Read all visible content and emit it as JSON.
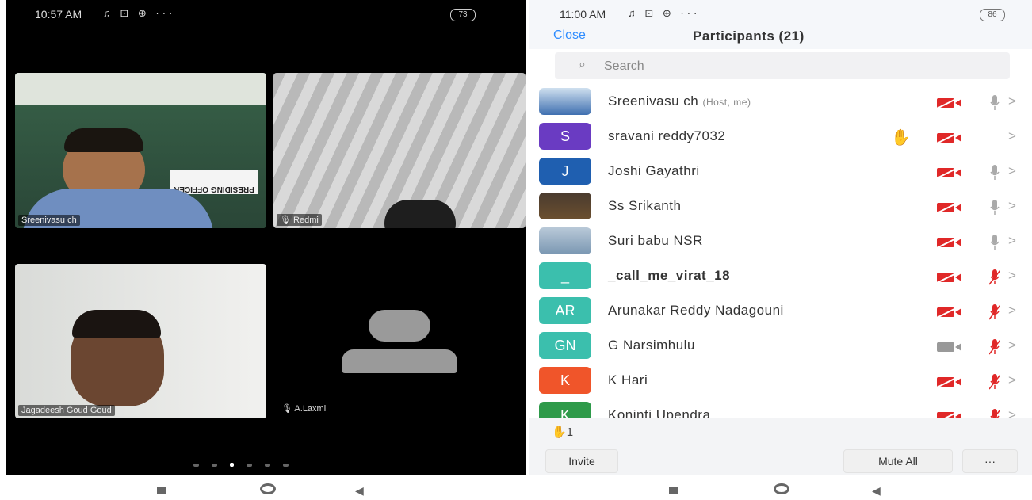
{
  "left_phone": {
    "status": {
      "time": "10:57 AM",
      "battery": "73"
    },
    "tiles": [
      {
        "label": "Sreenivasu ch",
        "sign": "PRESIDING OFFICER"
      },
      {
        "label": "Redmi"
      },
      {
        "label": "Jagadeesh Goud Goud"
      },
      {
        "label": "A.Laxmi"
      }
    ],
    "page_dots": 6,
    "active_dot": 3
  },
  "right_phone": {
    "status": {
      "time": "11:00 AM",
      "battery": "86"
    },
    "header": {
      "close": "Close",
      "title": "Participants (21)"
    },
    "search": {
      "placeholder": "Search"
    },
    "participants": [
      {
        "name": "Sreenivasu ch",
        "tag": "(Host, me)",
        "avatar": "photo",
        "mic": "on"
      },
      {
        "name": "sravani reddy7032",
        "initials": "S",
        "color": "#6a3bc2",
        "hand": true,
        "mic": "none"
      },
      {
        "name": "Joshi Gayathri",
        "initials": "J",
        "color": "#1f5fb0",
        "mic": "on"
      },
      {
        "name": "Ss Srikanth",
        "avatar": "photo",
        "mic": "on"
      },
      {
        "name": "Suri babu NSR",
        "avatar": "photo",
        "mic": "on"
      },
      {
        "name": "_call_me_virat_18",
        "initials": "_",
        "color": "#3bbfad",
        "mic": "muted"
      },
      {
        "name": "Arunakar Reddy Nadagouni",
        "initials": "AR",
        "color": "#3bbfad",
        "mic": "muted"
      },
      {
        "name": "G Narsimhulu",
        "initials": "GN",
        "color": "#3bbfad",
        "video": "on",
        "mic": "muted"
      },
      {
        "name": "K Hari",
        "initials": "K",
        "color": "#f0552a",
        "mic": "muted"
      },
      {
        "name": "Koninti Upendra",
        "initials": "K",
        "color": "#2e9a4a",
        "mic": "muted"
      }
    ],
    "raised_hands": "1",
    "footer": {
      "invite": "Invite",
      "mute_all": "Mute All",
      "more": "···"
    }
  },
  "colors": {
    "accent": "#2d8cff",
    "muted": "#e02828",
    "hand": "#f2b51b"
  }
}
